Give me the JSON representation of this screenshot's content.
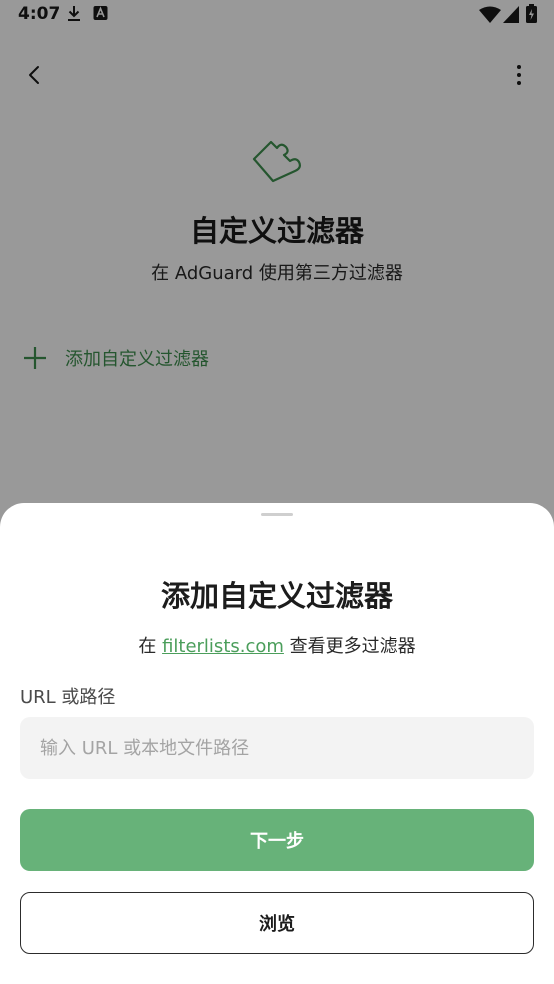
{
  "status_bar": {
    "time": "4:07",
    "icons": [
      "download-icon",
      "a-box-icon",
      "wifi-icon",
      "signal-icon",
      "battery-icon"
    ]
  },
  "page": {
    "title": "自定义过滤器",
    "subtitle": "在 AdGuard 使用第三方过滤器",
    "add_label": "添加自定义过滤器",
    "accent_color": "#3f8f4f"
  },
  "sheet": {
    "title": "添加自定义过滤器",
    "subtitle_prefix": "在 ",
    "subtitle_link": "filterlists.com",
    "subtitle_suffix": " 查看更多过滤器",
    "field_label": "URL 或路径",
    "input_placeholder": "输入 URL 或本地文件路径",
    "input_value": "",
    "next_label": "下一步",
    "browse_label": "浏览",
    "primary_color": "#67b279"
  }
}
